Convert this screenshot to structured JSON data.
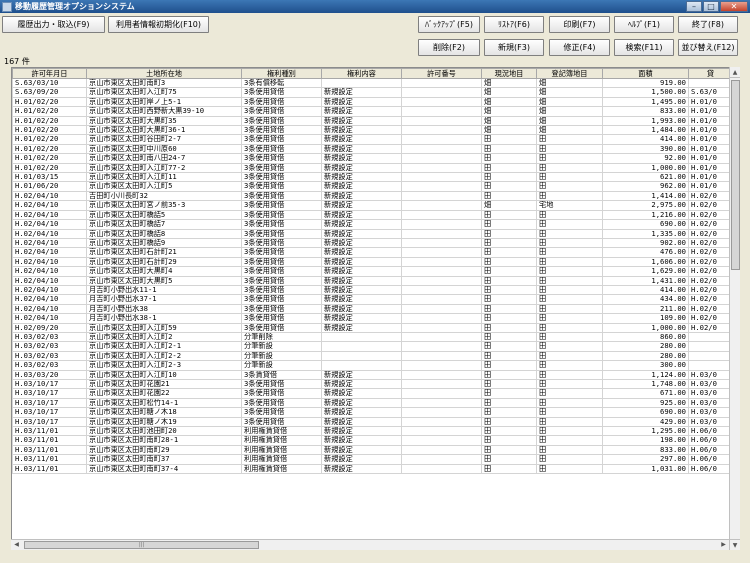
{
  "window": {
    "title": "移動履歴管理オプションシステム",
    "minimize": "–",
    "maximize": "□",
    "close": "✕"
  },
  "toolbar": {
    "history_output": "履歴出力・取込(F9)",
    "init_user": "利用者情報初期化(F10)",
    "backup": "ﾊﾞｯｸｱｯﾌﾟ(F5)",
    "restore": "ﾘｽﾄｱ(F6)",
    "print": "印刷(F7)",
    "help": "ﾍﾙﾌﾟ(F1)",
    "exit": "終了(F8)",
    "delete": "削除(F2)",
    "new": "新規(F3)",
    "edit": "修正(F4)",
    "search": "検索(F11)",
    "sort": "並び替え(F12)"
  },
  "record_count": "167 件",
  "columns": [
    "許可年月日",
    "土地所在地",
    "権利種別",
    "権利内容",
    "許可番号",
    "現況地目",
    "登記簿地目",
    "面積",
    "貸"
  ],
  "rows": [
    [
      "S.63/03/10",
      "京山市東区太田町南町3",
      "3条有償移転",
      "",
      "",
      "畑",
      "畑",
      "919.00",
      ""
    ],
    [
      "S.63/09/20",
      "京山市東区太田町入江町75",
      "3条使用貸借",
      "新規設定",
      "",
      "畑",
      "畑",
      "1,500.00",
      "S.63/0"
    ],
    [
      "H.01/02/20",
      "京山市東区太田町岸ノ上5-1",
      "3条使用貸借",
      "新規設定",
      "",
      "畑",
      "畑",
      "1,495.00",
      "H.01/0"
    ],
    [
      "H.01/02/20",
      "京山市東区太田町西野新大黒39-10",
      "3条使用貸借",
      "新規設定",
      "",
      "畑",
      "畑",
      "833.00",
      "H.01/0"
    ],
    [
      "H.01/02/20",
      "京山市東区太田町大黒町35",
      "3条使用貸借",
      "新規設定",
      "",
      "畑",
      "畑",
      "1,993.00",
      "H.01/0"
    ],
    [
      "H.01/02/20",
      "京山市東区太田町大黒町36-1",
      "3条使用貸借",
      "新規設定",
      "",
      "畑",
      "畑",
      "1,484.00",
      "H.01/0"
    ],
    [
      "H.01/02/20",
      "京山市東区太田町谷田町2-7",
      "3条使用貸借",
      "新規設定",
      "",
      "田",
      "田",
      "414.00",
      "H.01/0"
    ],
    [
      "H.01/02/20",
      "京山市東区太田町中川原60",
      "3条使用貸借",
      "新規設定",
      "",
      "田",
      "田",
      "390.00",
      "H.01/0"
    ],
    [
      "H.01/02/20",
      "京山市東区太田町南八田24-7",
      "3条使用貸借",
      "新規設定",
      "",
      "田",
      "田",
      "92.00",
      "H.01/0"
    ],
    [
      "H.01/02/20",
      "京山市東区太田町入江町77-2",
      "3条使用貸借",
      "新規設定",
      "",
      "田",
      "田",
      "1,000.00",
      "H.01/0"
    ],
    [
      "H.01/03/15",
      "京山市東区太田町入江町11",
      "3条使用貸借",
      "新規設定",
      "",
      "田",
      "田",
      "621.00",
      "H.01/0"
    ],
    [
      "H.01/06/20",
      "京山市東区太田町入江町5",
      "3条使用貸借",
      "新規設定",
      "",
      "田",
      "田",
      "962.00",
      "H.01/0"
    ],
    [
      "H.02/04/10",
      "吉田町小川長町32",
      "3条使用貸借",
      "新規設定",
      "",
      "田",
      "田",
      "1,414.00",
      "H.02/0"
    ],
    [
      "H.02/04/10",
      "京山市東区太田町宮ノ前35-3",
      "3条使用貸借",
      "新規設定",
      "",
      "畑",
      "宅地",
      "2,975.00",
      "H.02/0"
    ],
    [
      "H.02/04/10",
      "京山市東区太田町橋詰5",
      "3条使用貸借",
      "新規設定",
      "",
      "田",
      "田",
      "1,216.00",
      "H.02/0"
    ],
    [
      "H.02/04/10",
      "京山市東区太田町橋詰7",
      "3条使用貸借",
      "新規設定",
      "",
      "田",
      "田",
      "690.00",
      "H.02/0"
    ],
    [
      "H.02/04/10",
      "京山市東区太田町橋詰8",
      "3条使用貸借",
      "新規設定",
      "",
      "田",
      "田",
      "1,335.00",
      "H.02/0"
    ],
    [
      "H.02/04/10",
      "京山市東区太田町橋詰9",
      "3条使用貸借",
      "新規設定",
      "",
      "田",
      "田",
      "902.00",
      "H.02/0"
    ],
    [
      "H.02/04/10",
      "京山市東区太田町石計町21",
      "3条使用貸借",
      "新規設定",
      "",
      "田",
      "田",
      "476.00",
      "H.02/0"
    ],
    [
      "H.02/04/10",
      "京山市東区太田町石計町29",
      "3条使用貸借",
      "新規設定",
      "",
      "田",
      "田",
      "1,606.00",
      "H.02/0"
    ],
    [
      "H.02/04/10",
      "京山市東区太田町大黒町4",
      "3条使用貸借",
      "新規設定",
      "",
      "田",
      "田",
      "1,629.00",
      "H.02/0"
    ],
    [
      "H.02/04/10",
      "京山市東区太田町大黒町5",
      "3条使用貸借",
      "新規設定",
      "",
      "田",
      "田",
      "1,431.00",
      "H.02/0"
    ],
    [
      "H.02/04/10",
      "月吉町小野出水11-1",
      "3条使用貸借",
      "新規設定",
      "",
      "田",
      "田",
      "414.00",
      "H.02/0"
    ],
    [
      "H.02/04/10",
      "月吉町小野出水37-1",
      "3条使用貸借",
      "新規設定",
      "",
      "田",
      "田",
      "434.00",
      "H.02/0"
    ],
    [
      "H.02/04/10",
      "月吉町小野出水38",
      "3条使用貸借",
      "新規設定",
      "",
      "田",
      "田",
      "211.00",
      "H.02/0"
    ],
    [
      "H.02/04/10",
      "月吉町小野出水38-1",
      "3条使用貸借",
      "新規設定",
      "",
      "田",
      "田",
      "109.00",
      "H.02/0"
    ],
    [
      "H.02/09/20",
      "京山市東区太田町入江町59",
      "3条使用貸借",
      "新規設定",
      "",
      "田",
      "田",
      "1,000.00",
      "H.02/0"
    ],
    [
      "H.03/02/03",
      "京山市東区太田町入江町2",
      "分筆削除",
      "",
      "",
      "田",
      "田",
      "860.00",
      ""
    ],
    [
      "H.03/02/03",
      "京山市東区太田町入江町2-1",
      "分筆新設",
      "",
      "",
      "田",
      "田",
      "280.00",
      ""
    ],
    [
      "H.03/02/03",
      "京山市東区太田町入江町2-2",
      "分筆新設",
      "",
      "",
      "田",
      "田",
      "280.00",
      ""
    ],
    [
      "H.03/02/03",
      "京山市東区太田町入江町2-3",
      "分筆新設",
      "",
      "",
      "田",
      "田",
      "300.00",
      ""
    ],
    [
      "H.03/03/20",
      "京山市東区太田町入江町10",
      "3条賃貸借",
      "新規設定",
      "",
      "田",
      "田",
      "1,124.00",
      "H.03/0"
    ],
    [
      "H.03/10/17",
      "京山市東区太田町花園21",
      "3条使用貸借",
      "新規設定",
      "",
      "田",
      "田",
      "1,748.00",
      "H.03/0"
    ],
    [
      "H.03/10/17",
      "京山市東区太田町花園22",
      "3条使用貸借",
      "新規設定",
      "",
      "田",
      "田",
      "671.00",
      "H.03/0"
    ],
    [
      "H.03/10/17",
      "京山市東区太田町松竹14-1",
      "3条使用貸借",
      "新規設定",
      "",
      "田",
      "田",
      "925.00",
      "H.03/0"
    ],
    [
      "H.03/10/17",
      "京山市東区太田町糖ノ木18",
      "3条使用貸借",
      "新規設定",
      "",
      "田",
      "田",
      "690.00",
      "H.03/0"
    ],
    [
      "H.03/10/17",
      "京山市東区太田町糖ノ木19",
      "3条使用貸借",
      "新規設定",
      "",
      "田",
      "田",
      "429.00",
      "H.03/0"
    ],
    [
      "H.03/11/01",
      "京山市東区太田町池田町20",
      "利用権賃貸借",
      "新規設定",
      "",
      "田",
      "田",
      "1,295.00",
      "H.06/0"
    ],
    [
      "H.03/11/01",
      "京山市東区太田町南町28-1",
      "利用権賃貸借",
      "新規設定",
      "",
      "田",
      "田",
      "198.00",
      "H.06/0"
    ],
    [
      "H.03/11/01",
      "京山市東区太田町南町29",
      "利用権賃貸借",
      "新規設定",
      "",
      "田",
      "田",
      "833.00",
      "H.06/0"
    ],
    [
      "H.03/11/01",
      "京山市東区太田町南町37",
      "利用権賃貸借",
      "新規設定",
      "",
      "田",
      "田",
      "297.00",
      "H.06/0"
    ],
    [
      "H.03/11/01",
      "京山市東区太田町南町37-4",
      "利用権賃貸借",
      "新規設定",
      "",
      "田",
      "田",
      "1,031.00",
      "H.06/0"
    ]
  ]
}
